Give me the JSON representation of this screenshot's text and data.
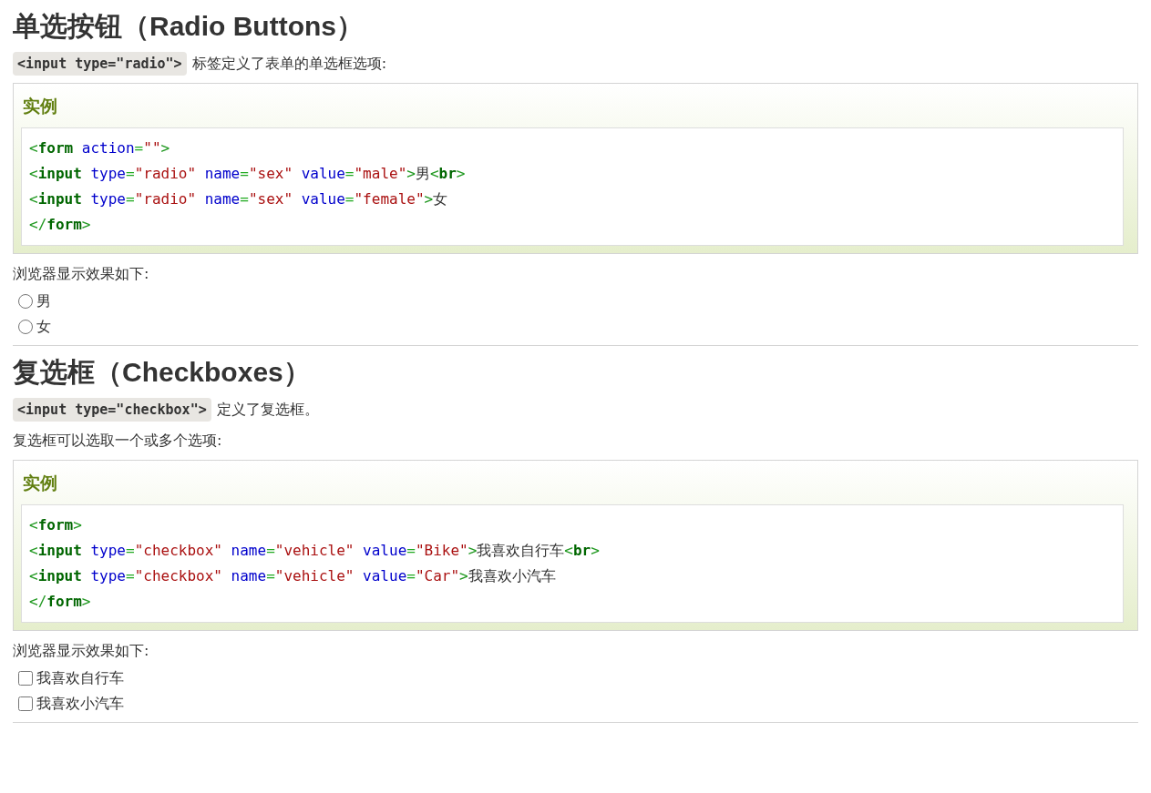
{
  "sections": [
    {
      "heading": "单选按钮（Radio Buttons）",
      "intro": [
        {
          "code": "<input type=\"radio\">",
          "text": "标签定义了表单的单选框选项:"
        }
      ],
      "example": {
        "label": "实例",
        "lines": [
          [
            {
              "kind": "bracket",
              "text": "<"
            },
            {
              "kind": "tag",
              "text": "form"
            },
            {
              "kind": "attr",
              "text": " action"
            },
            {
              "kind": "eq",
              "text": "="
            },
            {
              "kind": "str",
              "text": "\"\""
            },
            {
              "kind": "bracket",
              "text": ">"
            }
          ],
          [
            {
              "kind": "bracket",
              "text": "<"
            },
            {
              "kind": "tag",
              "text": "input"
            },
            {
              "kind": "attr",
              "text": " type"
            },
            {
              "kind": "eq",
              "text": "="
            },
            {
              "kind": "str",
              "text": "\"radio\""
            },
            {
              "kind": "attr",
              "text": " name"
            },
            {
              "kind": "eq",
              "text": "="
            },
            {
              "kind": "str",
              "text": "\"sex\""
            },
            {
              "kind": "attr",
              "text": " value"
            },
            {
              "kind": "eq",
              "text": "="
            },
            {
              "kind": "str",
              "text": "\"male\""
            },
            {
              "kind": "bracket",
              "text": ">"
            },
            {
              "kind": "text",
              "text": "男"
            },
            {
              "kind": "bracket",
              "text": "<"
            },
            {
              "kind": "tag",
              "text": "br"
            },
            {
              "kind": "bracket",
              "text": ">"
            }
          ],
          [
            {
              "kind": "bracket",
              "text": "<"
            },
            {
              "kind": "tag",
              "text": "input"
            },
            {
              "kind": "attr",
              "text": " type"
            },
            {
              "kind": "eq",
              "text": "="
            },
            {
              "kind": "str",
              "text": "\"radio\""
            },
            {
              "kind": "attr",
              "text": " name"
            },
            {
              "kind": "eq",
              "text": "="
            },
            {
              "kind": "str",
              "text": "\"sex\""
            },
            {
              "kind": "attr",
              "text": " value"
            },
            {
              "kind": "eq",
              "text": "="
            },
            {
              "kind": "str",
              "text": "\"female\""
            },
            {
              "kind": "bracket",
              "text": ">"
            },
            {
              "kind": "text",
              "text": "女"
            }
          ],
          [
            {
              "kind": "bracket",
              "text": "</"
            },
            {
              "kind": "tag",
              "text": "form"
            },
            {
              "kind": "bracket",
              "text": ">"
            }
          ]
        ]
      },
      "result_label": "浏览器显示效果如下:",
      "options": [
        {
          "kind": "radio",
          "label": "男",
          "selected": false
        },
        {
          "kind": "radio",
          "label": "女",
          "selected": false
        }
      ]
    },
    {
      "heading": "复选框（Checkboxes）",
      "intro": [
        {
          "code": "<input type=\"checkbox\">",
          "text": "定义了复选框。"
        },
        {
          "text": "复选框可以选取一个或多个选项:"
        }
      ],
      "example": {
        "label": "实例",
        "lines": [
          [
            {
              "kind": "bracket",
              "text": "<"
            },
            {
              "kind": "tag",
              "text": "form"
            },
            {
              "kind": "bracket",
              "text": ">"
            }
          ],
          [
            {
              "kind": "bracket",
              "text": "<"
            },
            {
              "kind": "tag",
              "text": "input"
            },
            {
              "kind": "attr",
              "text": " type"
            },
            {
              "kind": "eq",
              "text": "="
            },
            {
              "kind": "str",
              "text": "\"checkbox\""
            },
            {
              "kind": "attr",
              "text": " name"
            },
            {
              "kind": "eq",
              "text": "="
            },
            {
              "kind": "str",
              "text": "\"vehicle\""
            },
            {
              "kind": "attr",
              "text": " value"
            },
            {
              "kind": "eq",
              "text": "="
            },
            {
              "kind": "str",
              "text": "\"Bike\""
            },
            {
              "kind": "bracket",
              "text": ">"
            },
            {
              "kind": "text",
              "text": "我喜欢自行车"
            },
            {
              "kind": "bracket",
              "text": "<"
            },
            {
              "kind": "tag",
              "text": "br"
            },
            {
              "kind": "bracket",
              "text": ">"
            }
          ],
          [
            {
              "kind": "bracket",
              "text": "<"
            },
            {
              "kind": "tag",
              "text": "input"
            },
            {
              "kind": "attr",
              "text": " type"
            },
            {
              "kind": "eq",
              "text": "="
            },
            {
              "kind": "str",
              "text": "\"checkbox\""
            },
            {
              "kind": "attr",
              "text": " name"
            },
            {
              "kind": "eq",
              "text": "="
            },
            {
              "kind": "str",
              "text": "\"vehicle\""
            },
            {
              "kind": "attr",
              "text": " value"
            },
            {
              "kind": "eq",
              "text": "="
            },
            {
              "kind": "str",
              "text": "\"Car\""
            },
            {
              "kind": "bracket",
              "text": ">"
            },
            {
              "kind": "text",
              "text": "我喜欢小汽车"
            }
          ],
          [
            {
              "kind": "bracket",
              "text": "</"
            },
            {
              "kind": "tag",
              "text": "form"
            },
            {
              "kind": "bracket",
              "text": ">"
            }
          ]
        ]
      },
      "result_label": "浏览器显示效果如下:",
      "options": [
        {
          "kind": "checkbox",
          "label": "我喜欢自行车",
          "checked": false
        },
        {
          "kind": "checkbox",
          "label": "我喜欢小汽车",
          "checked": false
        }
      ]
    }
  ]
}
